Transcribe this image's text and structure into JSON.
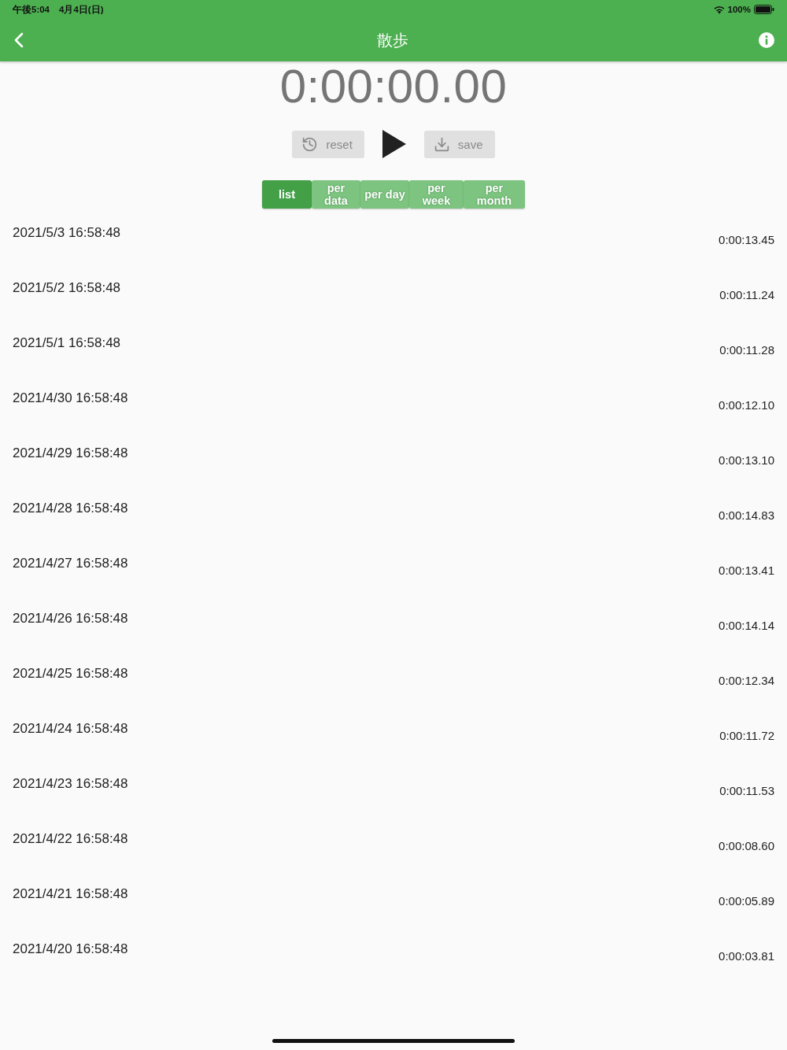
{
  "status_bar": {
    "time": "午後5:04",
    "date": "4月4日(日)",
    "battery": "100%"
  },
  "app_bar": {
    "title": "散歩"
  },
  "timer": {
    "display": "0:00:00.00"
  },
  "controls": {
    "reset": "reset",
    "save": "save"
  },
  "tabs": [
    {
      "label": "list",
      "selected": true
    },
    {
      "label": "per data",
      "selected": false
    },
    {
      "label": "per day",
      "selected": false
    },
    {
      "label": "per week",
      "selected": false
    },
    {
      "label": "per month",
      "selected": false
    }
  ],
  "records": [
    {
      "date": "2021/5/3 16:58:48",
      "duration": "0:00:13.45"
    },
    {
      "date": "2021/5/2 16:58:48",
      "duration": "0:00:11.24"
    },
    {
      "date": "2021/5/1 16:58:48",
      "duration": "0:00:11.28"
    },
    {
      "date": "2021/4/30 16:58:48",
      "duration": "0:00:12.10"
    },
    {
      "date": "2021/4/29 16:58:48",
      "duration": "0:00:13.10"
    },
    {
      "date": "2021/4/28 16:58:48",
      "duration": "0:00:14.83"
    },
    {
      "date": "2021/4/27 16:58:48",
      "duration": "0:00:13.41"
    },
    {
      "date": "2021/4/26 16:58:48",
      "duration": "0:00:14.14"
    },
    {
      "date": "2021/4/25 16:58:48",
      "duration": "0:00:12.34"
    },
    {
      "date": "2021/4/24 16:58:48",
      "duration": "0:00:11.72"
    },
    {
      "date": "2021/4/23 16:58:48",
      "duration": "0:00:11.53"
    },
    {
      "date": "2021/4/22 16:58:48",
      "duration": "0:00:08.60"
    },
    {
      "date": "2021/4/21 16:58:48",
      "duration": "0:00:05.89"
    },
    {
      "date": "2021/4/20 16:58:48",
      "duration": "0:00:03.81"
    }
  ]
}
